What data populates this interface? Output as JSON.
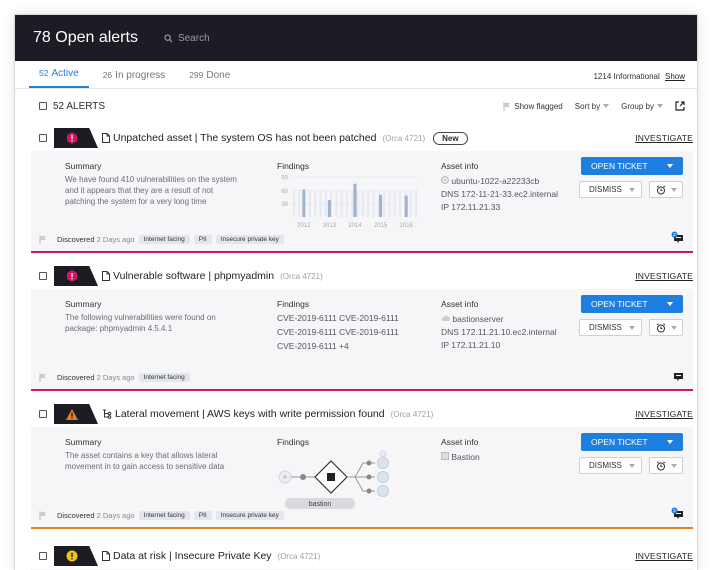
{
  "header": {
    "title": "78 Open alerts",
    "search_placeholder": "Search"
  },
  "tabs": [
    {
      "num": "52",
      "label": "Active"
    },
    {
      "num": "26",
      "label": "In progress"
    },
    {
      "num": "299",
      "label": "Done"
    }
  ],
  "informational": {
    "count": "1214",
    "label": "Informational",
    "show": "Show"
  },
  "list": {
    "count_label": "52 ALERTS",
    "show_flagged": "Show flagged",
    "sort_by": "Sort by",
    "group_by": "Group by"
  },
  "colors": {
    "accent": "#1f7fe0",
    "high": "#d11464",
    "medium": "#e77f22",
    "header_bg": "#1c1c24"
  },
  "alerts": [
    {
      "title": "Unpatched asset | The system OS has not been patched",
      "orca": "(Orca 4721)",
      "badge": "New",
      "investigate": "INVESTIGATE",
      "severity_icon": "hexagon-alert-icon",
      "summary_h": "Summary",
      "summary": [
        "We have found 410 vulnerabilities on the system",
        "and it appears that they are a result of not",
        "patching the system for a very long time"
      ],
      "findings_h": "Findings",
      "chart_data": {
        "type": "bar",
        "categories": [
          "2012",
          "2013",
          "2014",
          "2015",
          "2016"
        ],
        "yticks": [
          "90",
          "60",
          "30"
        ],
        "values": [
          62,
          38,
          75,
          50,
          48
        ]
      },
      "asset_h": "Asset info",
      "asset": [
        "ubuntu-1022-a22233cb",
        "DNS 172-11-21-33.ec2.internal",
        "IP 172.11.21.33"
      ],
      "open_ticket": "OPEN TICKET",
      "dismiss": "DISMISS",
      "discovered": "Discovered",
      "discovered_when": "2 Days ago",
      "tags": [
        "Internet facing",
        "PII",
        "Insecure private key"
      ],
      "chat_badge": "2"
    },
    {
      "title": "Vulnerable software  | phpmyadmin",
      "orca": "(Orca 4721)",
      "investigate": "INVESTIGATE",
      "severity_icon": "hexagon-alert-icon",
      "summary_h": "Summary",
      "summary": [
        "The following vulnerabilities were found on",
        "package: phpmyadmin 4.5.4.1"
      ],
      "findings_h": "Findings",
      "findings": [
        "CVE-2019-6111  CVE-2019-6111",
        "CVE-2019-6111  CVE-2019-6111",
        "CVE-2019-6111  +4"
      ],
      "asset_h": "Asset info",
      "asset": [
        "bastionserver",
        "DNS 172.11.21.10.ec2.internal",
        "IP 172.11.21.10"
      ],
      "open_ticket": "OPEN TICKET",
      "dismiss": "DISMISS",
      "discovered": "Discovered",
      "discovered_when": "2 Days ago",
      "tags": [
        "Internet facing"
      ]
    },
    {
      "title": "Lateral movement  | AWS keys with write permission found",
      "orca": "(Orca 4721)",
      "investigate": "INVESTIGATE",
      "severity_icon": "warning-triangle-icon",
      "summary_h": "Summary",
      "summary": [
        "The asset contains a key that allows lateral",
        "movement in to gain access to sensitive data"
      ],
      "findings_h": "Findings",
      "graph_label": "bastion",
      "asset_h": "Asset info",
      "asset": [
        "Bastion"
      ],
      "open_ticket": "OPEN TICKET",
      "dismiss": "DISMISS",
      "discovered": "Discovered",
      "discovered_when": "2 Days ago",
      "tags": [
        "Internet facing",
        "PII",
        "Insecure private key"
      ],
      "chat_badge": "2"
    },
    {
      "title": "Data at risk   | Insecure Private Key",
      "orca": "(Orca 4721)",
      "investigate": "INVESTIGATE",
      "severity_icon": "exclamation-circle-icon"
    }
  ]
}
